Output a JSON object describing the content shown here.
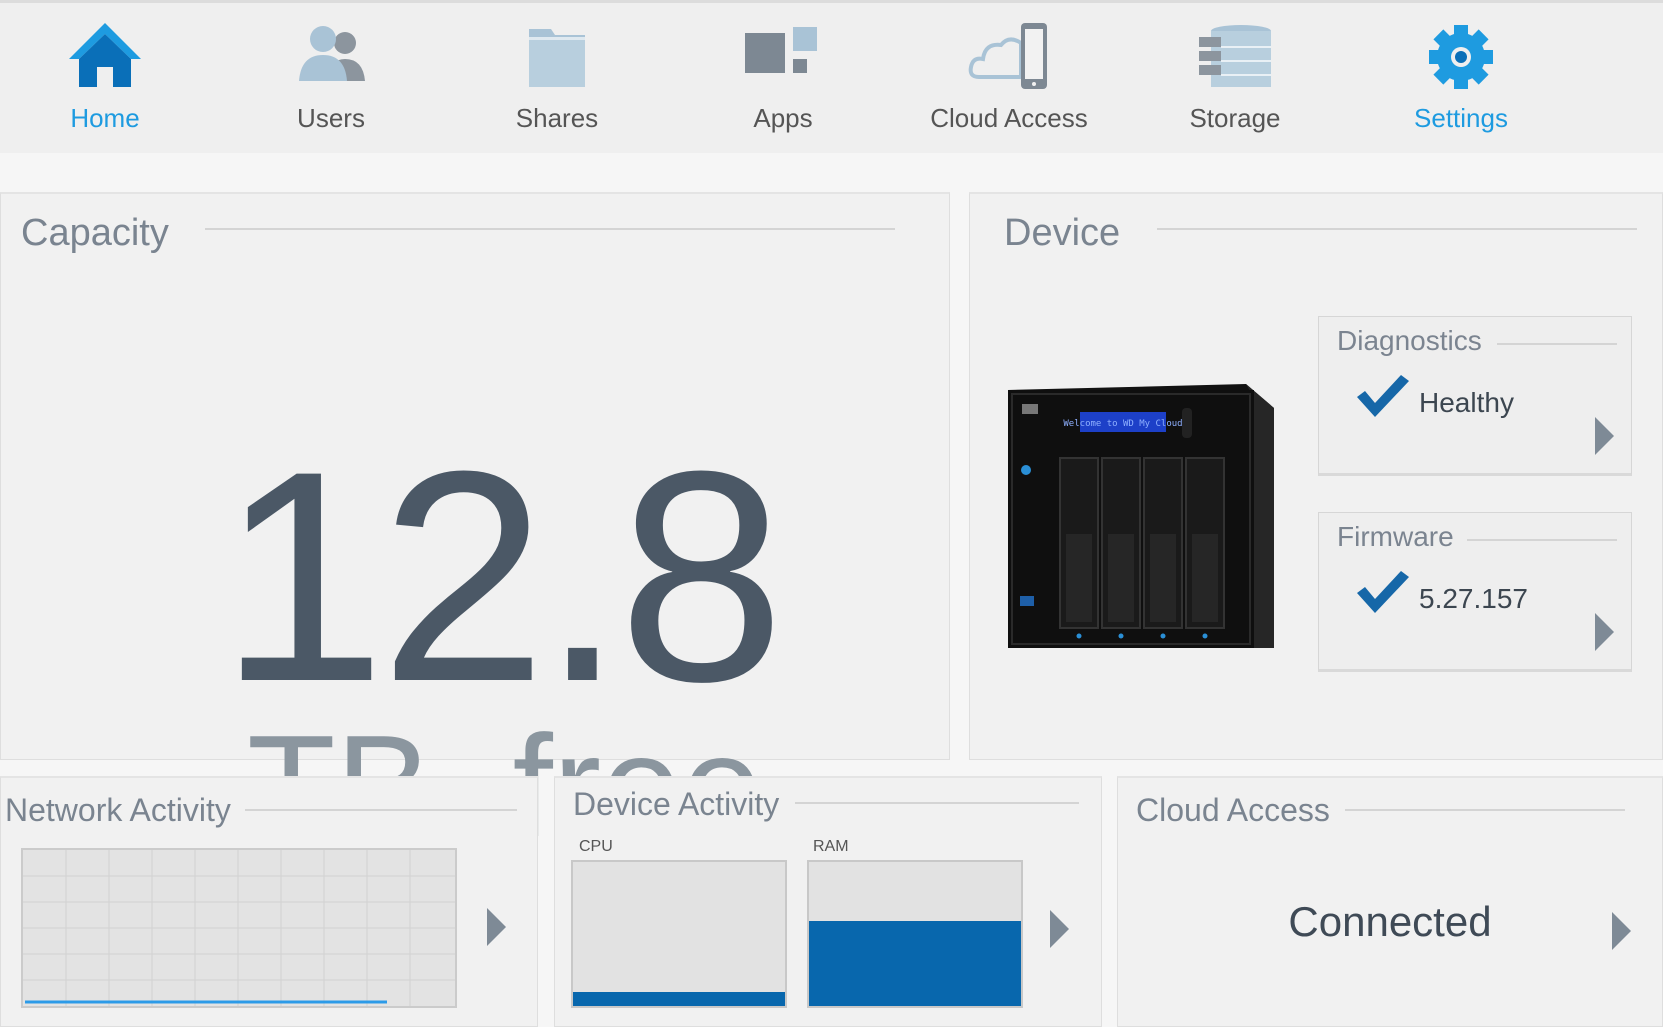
{
  "nav": {
    "items": [
      {
        "label": "Home",
        "icon": "home-icon",
        "active": true
      },
      {
        "label": "Users",
        "icon": "users-icon",
        "active": false
      },
      {
        "label": "Shares",
        "icon": "folder-icon",
        "active": false
      },
      {
        "label": "Apps",
        "icon": "apps-icon",
        "active": false
      },
      {
        "label": "Cloud Access",
        "icon": "cloud-device-icon",
        "active": false
      },
      {
        "label": "Storage",
        "icon": "storage-icon",
        "active": false
      },
      {
        "label": "Settings",
        "icon": "gear-icon",
        "active": true
      }
    ],
    "active_color": "#1e9be0"
  },
  "capacity": {
    "title": "Capacity",
    "value": "12.8",
    "unit": "TB  free"
  },
  "device": {
    "title": "Device",
    "device_screen_text": "Welcome to WD My Cloud",
    "diagnostics": {
      "title": "Diagnostics",
      "value": "Healthy"
    },
    "firmware": {
      "title": "Firmware",
      "value": "5.27.157"
    }
  },
  "network_activity": {
    "title": "Network Activity"
  },
  "device_activity": {
    "title": "Device Activity",
    "cpu_label": "CPU",
    "ram_label": "RAM",
    "cpu_level": 0.1,
    "ram_level": 0.59
  },
  "cloud_access": {
    "title": "Cloud Access",
    "status": "Connected"
  },
  "colors": {
    "accent": "#1e9be0",
    "meter_fill": "#0867ad",
    "check": "#1667a8"
  }
}
